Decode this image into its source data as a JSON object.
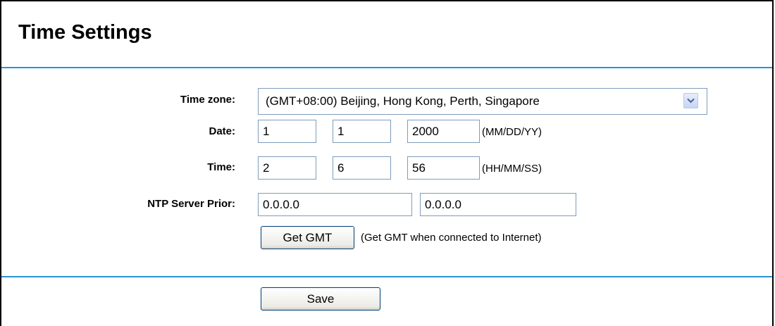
{
  "page": {
    "title": "Time Settings"
  },
  "colors": {
    "rule": "#2b93d1",
    "field_border": "#7f9db9",
    "button_border": "#003c74"
  },
  "form": {
    "timezone": {
      "label": "Time zone:",
      "value": "(GMT+08:00) Beijing, Hong Kong, Perth, Singapore",
      "arrow_icon": "chevron-down-icon"
    },
    "date": {
      "label": "Date:",
      "mm": "1",
      "dd": "1",
      "yy": "2000",
      "format": "(MM/DD/YY)"
    },
    "time": {
      "label": "Time:",
      "hh": "2",
      "mm": "6",
      "ss": "56",
      "format": "(HH/MM/SS)"
    },
    "ntp": {
      "label": "NTP Server Prior:",
      "primary": "0.0.0.0",
      "secondary": "0.0.0.0"
    },
    "get_gmt": {
      "label": "Get GMT",
      "hint": "(Get GMT when connected to Internet)"
    }
  },
  "actions": {
    "save_label": "Save"
  }
}
